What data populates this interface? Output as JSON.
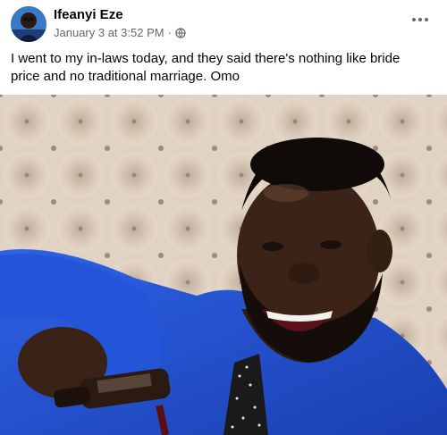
{
  "post": {
    "author_name": "Ifeanyi Eze",
    "timestamp": "January 3 at 3:52 PM",
    "separator": "·",
    "audience_icon": "globe-icon",
    "more_icon": "more-options-icon",
    "text": "I went to my in-laws today, and they said there's nothing like bride price and no traditional marriage. Omo"
  },
  "colors": {
    "name": "#050505",
    "meta": "#65676b",
    "shirt": "#1f4fd1",
    "sofa": "#d8c9b8"
  }
}
